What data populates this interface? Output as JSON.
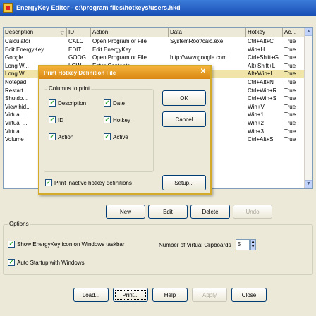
{
  "window": {
    "title": "EnergyKey Editor - c:\\program files\\hotkeys\\users.hkd"
  },
  "table": {
    "columns": [
      "Description",
      "ID",
      "Action",
      "Data",
      "Hotkey",
      "Ac..."
    ],
    "sorted_column": "Description",
    "rows": [
      [
        "Calculator",
        "CALC",
        "Open Program or File",
        "SystemRoot\\calc.exe",
        "Ctrl+Alt+C",
        "True"
      ],
      [
        "Edit EnergyKey",
        "EDIT",
        "Edit EnergyKey",
        "",
        "Win+H",
        "True"
      ],
      [
        "Google",
        "GOOG",
        "Open Program or File",
        "http://www.google.com",
        "Ctrl+Shift+G",
        "True"
      ],
      [
        "Long W...",
        "LOW...",
        "Enter Contents...",
        "...",
        "Alt+Shift+L",
        "True"
      ],
      [
        "Long W...",
        "",
        "",
        "",
        "Alt+Win+L",
        "True"
      ],
      [
        "Notepad",
        "",
        "",
        "...adexe",
        "Ctrl+Alt+N",
        "True"
      ],
      [
        "Restart",
        "",
        "",
        "",
        "Ctrl+Win+R",
        "True"
      ],
      [
        "Shutdo...",
        "",
        "",
        "",
        "Ctrl+Win+S",
        "True"
      ],
      [
        "View hid...",
        "",
        "",
        "",
        "Win+V",
        "True"
      ],
      [
        "Virtual ...",
        "",
        "",
        "",
        "Win+1",
        "True"
      ],
      [
        "Virtual ...",
        "",
        "",
        "",
        "Win+2",
        "True"
      ],
      [
        "Virtual ...",
        "",
        "",
        "",
        "Win+3",
        "True"
      ],
      [
        "Volume",
        "",
        "",
        "32.exe",
        "Ctrl+Alt+S",
        "True"
      ]
    ],
    "selected_row": 4
  },
  "list_buttons": {
    "new": "New",
    "edit": "Edit",
    "delete": "Delete",
    "undo": "Undo"
  },
  "options": {
    "label": "Options",
    "show_icon": "Show EnergyKey icon on Windows taskbar",
    "auto_startup": "Auto Startup with Windows",
    "virtual_clipboards_label": "Number of Virtual Clipboards",
    "virtual_clipboards_value": "5"
  },
  "footer_buttons": {
    "load": "Load...",
    "print": "Print...",
    "help": "Help",
    "apply": "Apply",
    "close": "Close"
  },
  "dialog": {
    "title": "Print Hotkey Definition File",
    "columns_group": "Columns to print",
    "check_description": "Description",
    "check_date": "Date",
    "check_id": "ID",
    "check_hotkey": "Hotkey",
    "check_action": "Action",
    "check_active": "Active",
    "print_inactive": "Print inactive hotkey definitions",
    "ok": "OK",
    "cancel": "Cancel",
    "setup": "Setup..."
  }
}
